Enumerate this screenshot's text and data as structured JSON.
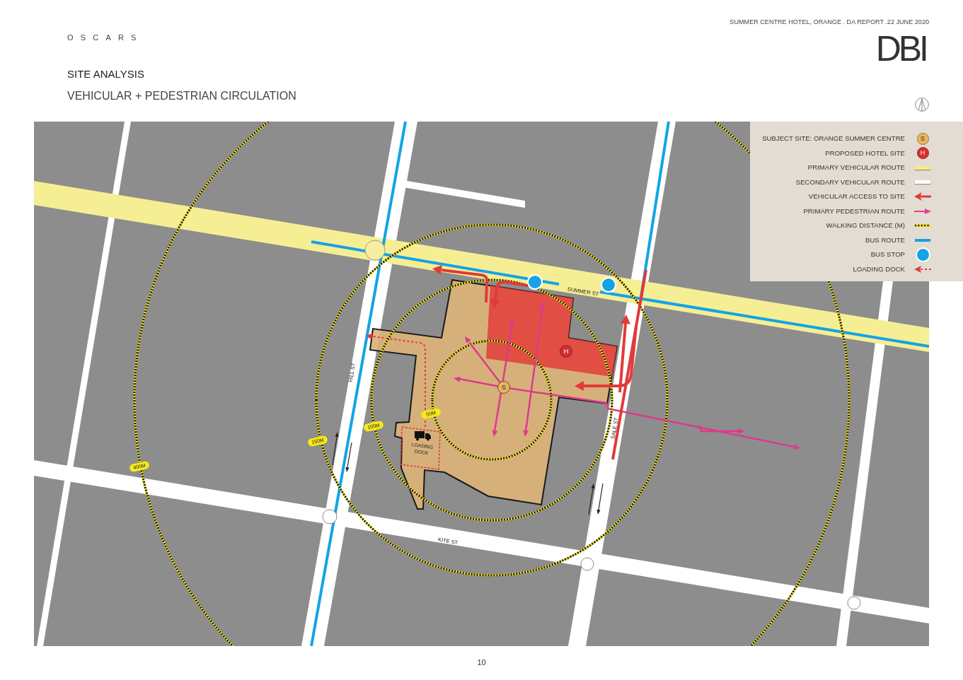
{
  "header": {
    "brand": "OSCARS",
    "report_info": "SUMMER CENTRE HOTEL, ORANGE . DA REPORT .22 JUNE 2020",
    "logo": "DBI",
    "section": "SITE ANALYSIS",
    "title": "VEHICULAR + PEDESTRIAN CIRCULATION"
  },
  "map": {
    "street_labels": [
      "SUMMER ST",
      "HILL ST",
      "SALE ST",
      "KITE ST"
    ],
    "distance_labels": [
      "50M",
      "100M",
      "150M",
      "400M"
    ],
    "site_marker": "S",
    "hotel_marker": "H",
    "loading_dock_label": "LOADING DOCK",
    "legend": [
      {
        "kind": "site",
        "label": "SUBJECT SITE: ORANGE SUMMER CENTRE",
        "symbol": "S"
      },
      {
        "kind": "hotel",
        "label": "PROPOSED HOTEL SITE",
        "symbol": "H"
      },
      {
        "kind": "primary-route",
        "label": "PRIMARY VEHICULAR ROUTE"
      },
      {
        "kind": "secondary-route",
        "label": "SECONDARY VEHICULAR ROUTE"
      },
      {
        "kind": "access",
        "label": "VEHICULAR ACCESS TO SITE"
      },
      {
        "kind": "pedestrian",
        "label": "PRIMARY PEDESTRIAN ROUTE"
      },
      {
        "kind": "walking",
        "label": "WALKING DISTANCE (M)"
      },
      {
        "kind": "bus-route",
        "label": "BUS ROUTE"
      },
      {
        "kind": "bus-stop",
        "label": "BUS STOP"
      },
      {
        "kind": "loading",
        "label": "LOADING DOCK"
      }
    ]
  },
  "page_number": "10"
}
